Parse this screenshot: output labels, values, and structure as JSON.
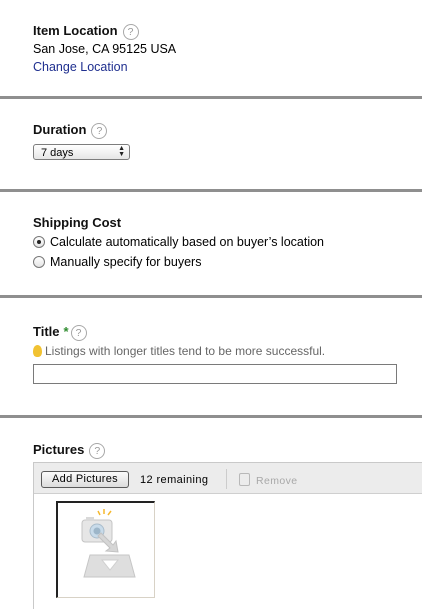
{
  "item_location": {
    "heading": "Item Location",
    "value": "San Jose, CA 95125 USA",
    "change_link": "Change Location"
  },
  "duration": {
    "heading": "Duration",
    "selected": "7 days"
  },
  "shipping": {
    "heading": "Shipping Cost",
    "options": [
      {
        "label": "Calculate automatically based on buyer’s location",
        "selected": true
      },
      {
        "label": "Manually specify for buyers",
        "selected": false
      }
    ]
  },
  "title_section": {
    "heading": "Title",
    "required_mark": "*",
    "tip": "Listings with longer titles tend to be more successful.",
    "value": ""
  },
  "pictures": {
    "heading": "Pictures",
    "add_label": "Add Pictures",
    "remaining": "12 remaining",
    "remove_label": "Remove"
  },
  "help_glyph": "?",
  "icons": [
    "help-icon",
    "chevron-updown-icon",
    "lightbulb-icon",
    "remove-icon",
    "camera-placeholder-icon"
  ]
}
